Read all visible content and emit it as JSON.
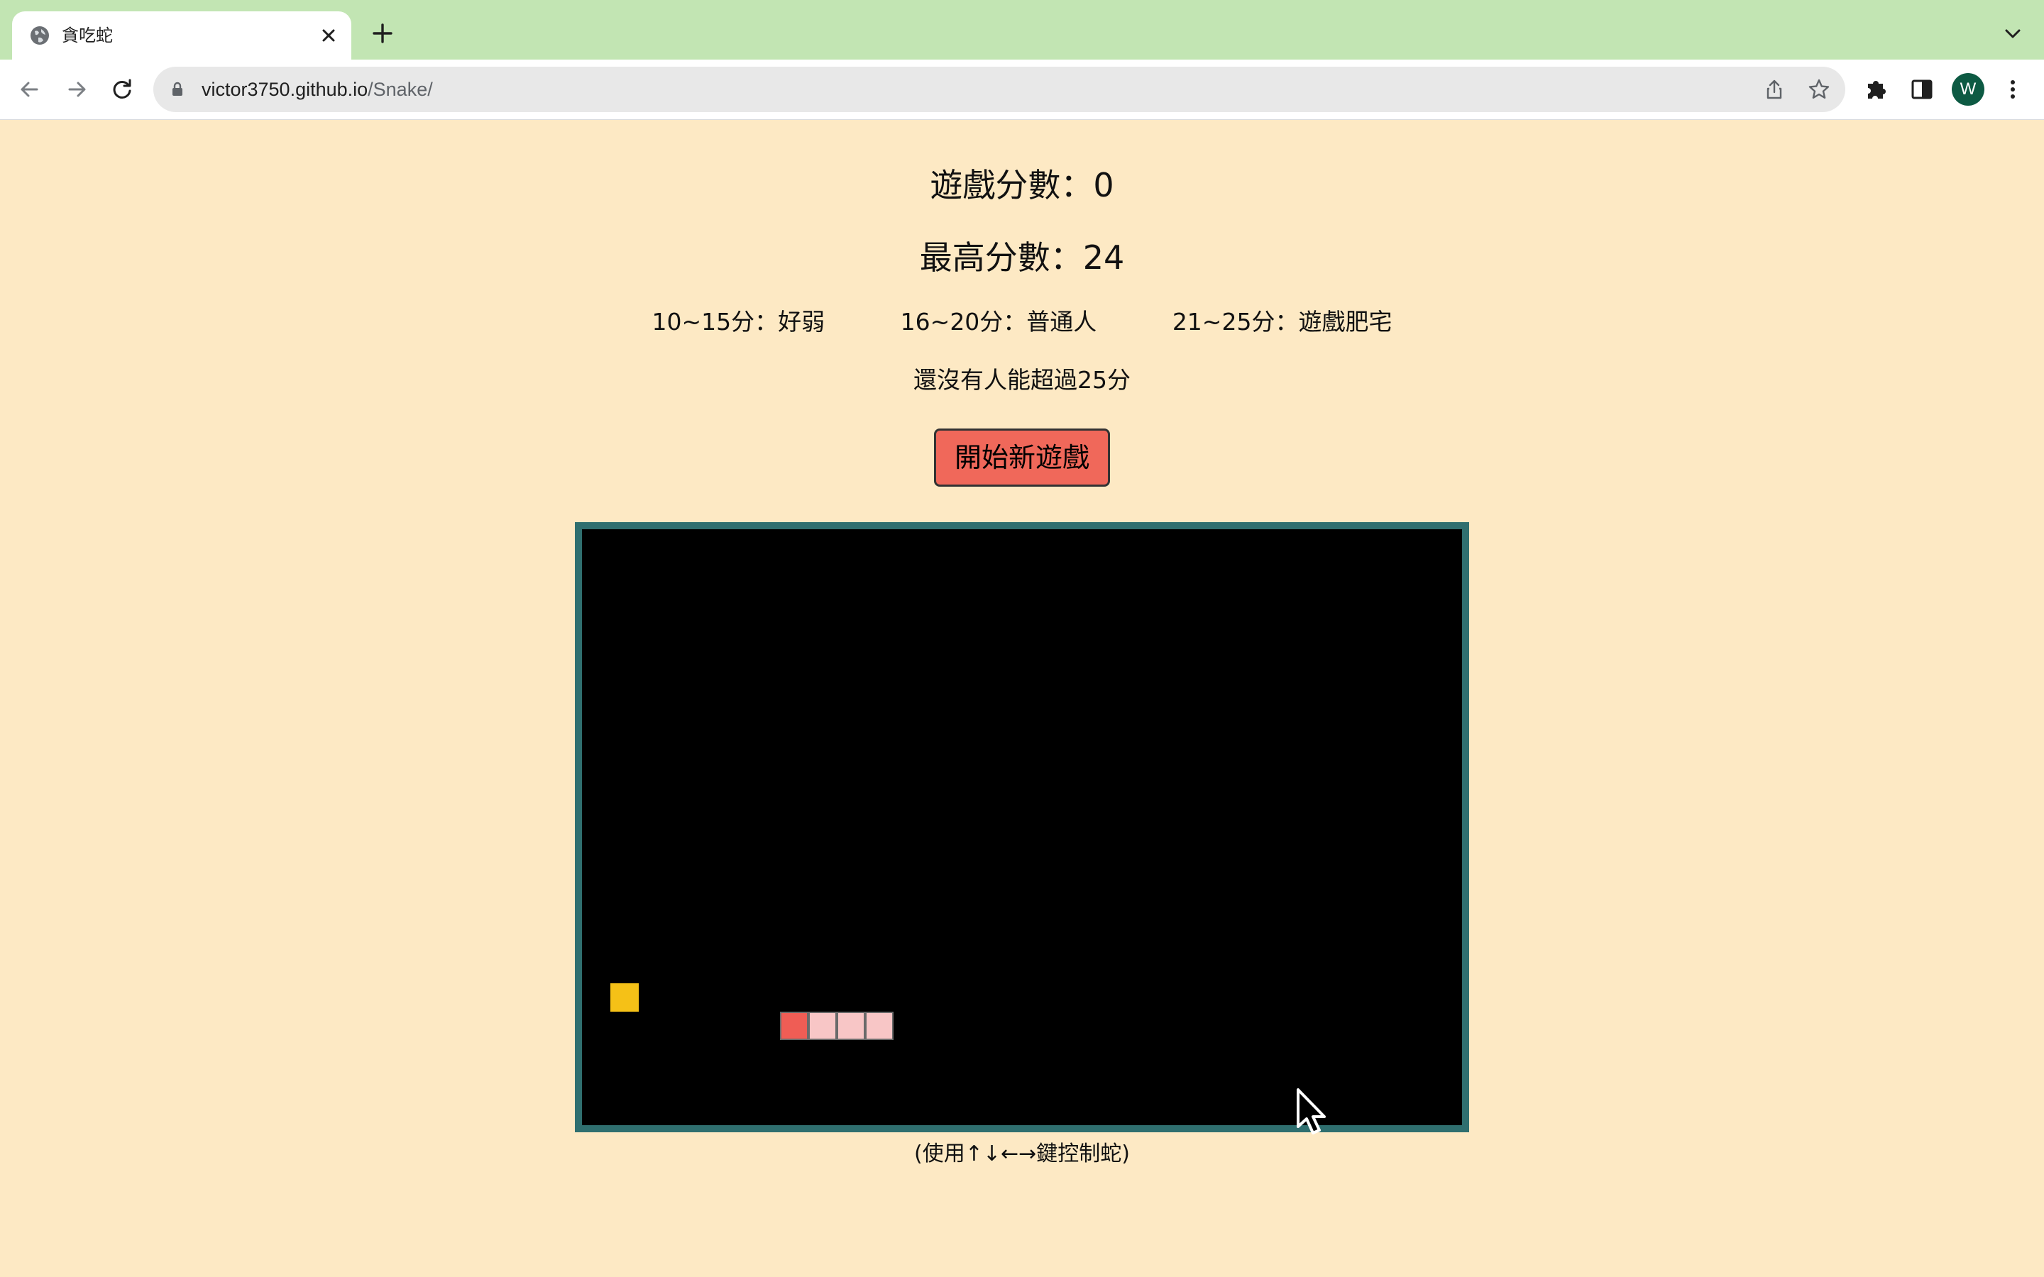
{
  "browser": {
    "tab_title": "貪吃蛇",
    "url_host": "victor3750.github.io",
    "url_path": "/Snake/",
    "profile_initial": "W"
  },
  "game": {
    "score_text": "遊戲分數：0",
    "high_score_text": "最高分數：24",
    "ranks": [
      "10~15分：好弱",
      "16~20分：普通人",
      "21~25分：遊戲肥宅"
    ],
    "note": "還沒有人能超過25分",
    "start_button": "開始新遊戲",
    "hint": "(使用↑↓←→鍵控制蛇)",
    "colors": {
      "board_border": "#2f6f6f",
      "snake_head": "#ef5d55",
      "snake_body": "#f8c6c6",
      "food": "#f5c117"
    }
  }
}
